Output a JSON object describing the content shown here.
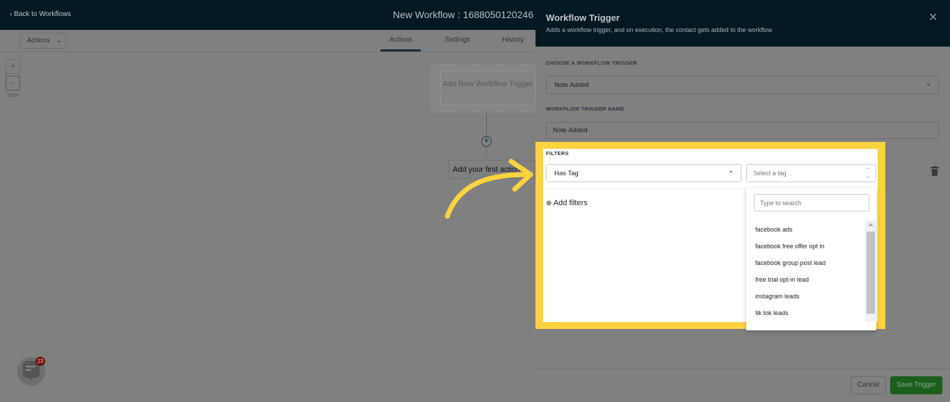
{
  "topbar": {
    "back_label": "Back to Workflows",
    "workflow_title": "New Workflow : 1688050120246"
  },
  "toolbar": {
    "actions_dropdown": "Actions",
    "tabs": [
      {
        "label": "Actions",
        "active": true
      },
      {
        "label": "Settings"
      },
      {
        "label": "History"
      }
    ]
  },
  "canvas": {
    "zoom_in": "+",
    "zoom_out": "−",
    "zoom_level": "100%",
    "trigger_card": "Add New Workflow Trigger",
    "first_action": "Add your first action"
  },
  "panel": {
    "title": "Workflow Trigger",
    "subtitle": "Adds a workflow trigger, and on execution, the contact gets added to the workflow",
    "choose_label": "CHOOSE A WORKFLOW TRIGGER",
    "choose_value": "Note Added",
    "name_label": "WORKFLOW TRIGGER NAME",
    "name_value": "Note Added",
    "filters_label": "FILTERS",
    "filter_type": "Has Tag",
    "tag_placeholder": "Select a tag",
    "add_filters": "Add filters",
    "search_placeholder": "Type to search",
    "tag_options": [
      "facebook ads",
      "facebook free offer opt in",
      "facebook group post lead",
      "free trial opt-in lead",
      "instagram leads",
      "tik tok leads"
    ],
    "cancel": "Cancel",
    "save": "Save Trigger"
  },
  "chat": {
    "badge": "23"
  },
  "colors": {
    "header": "#051923",
    "highlight": "#ffd23f",
    "save": "#1c5e1c",
    "overlay": "#808080"
  }
}
